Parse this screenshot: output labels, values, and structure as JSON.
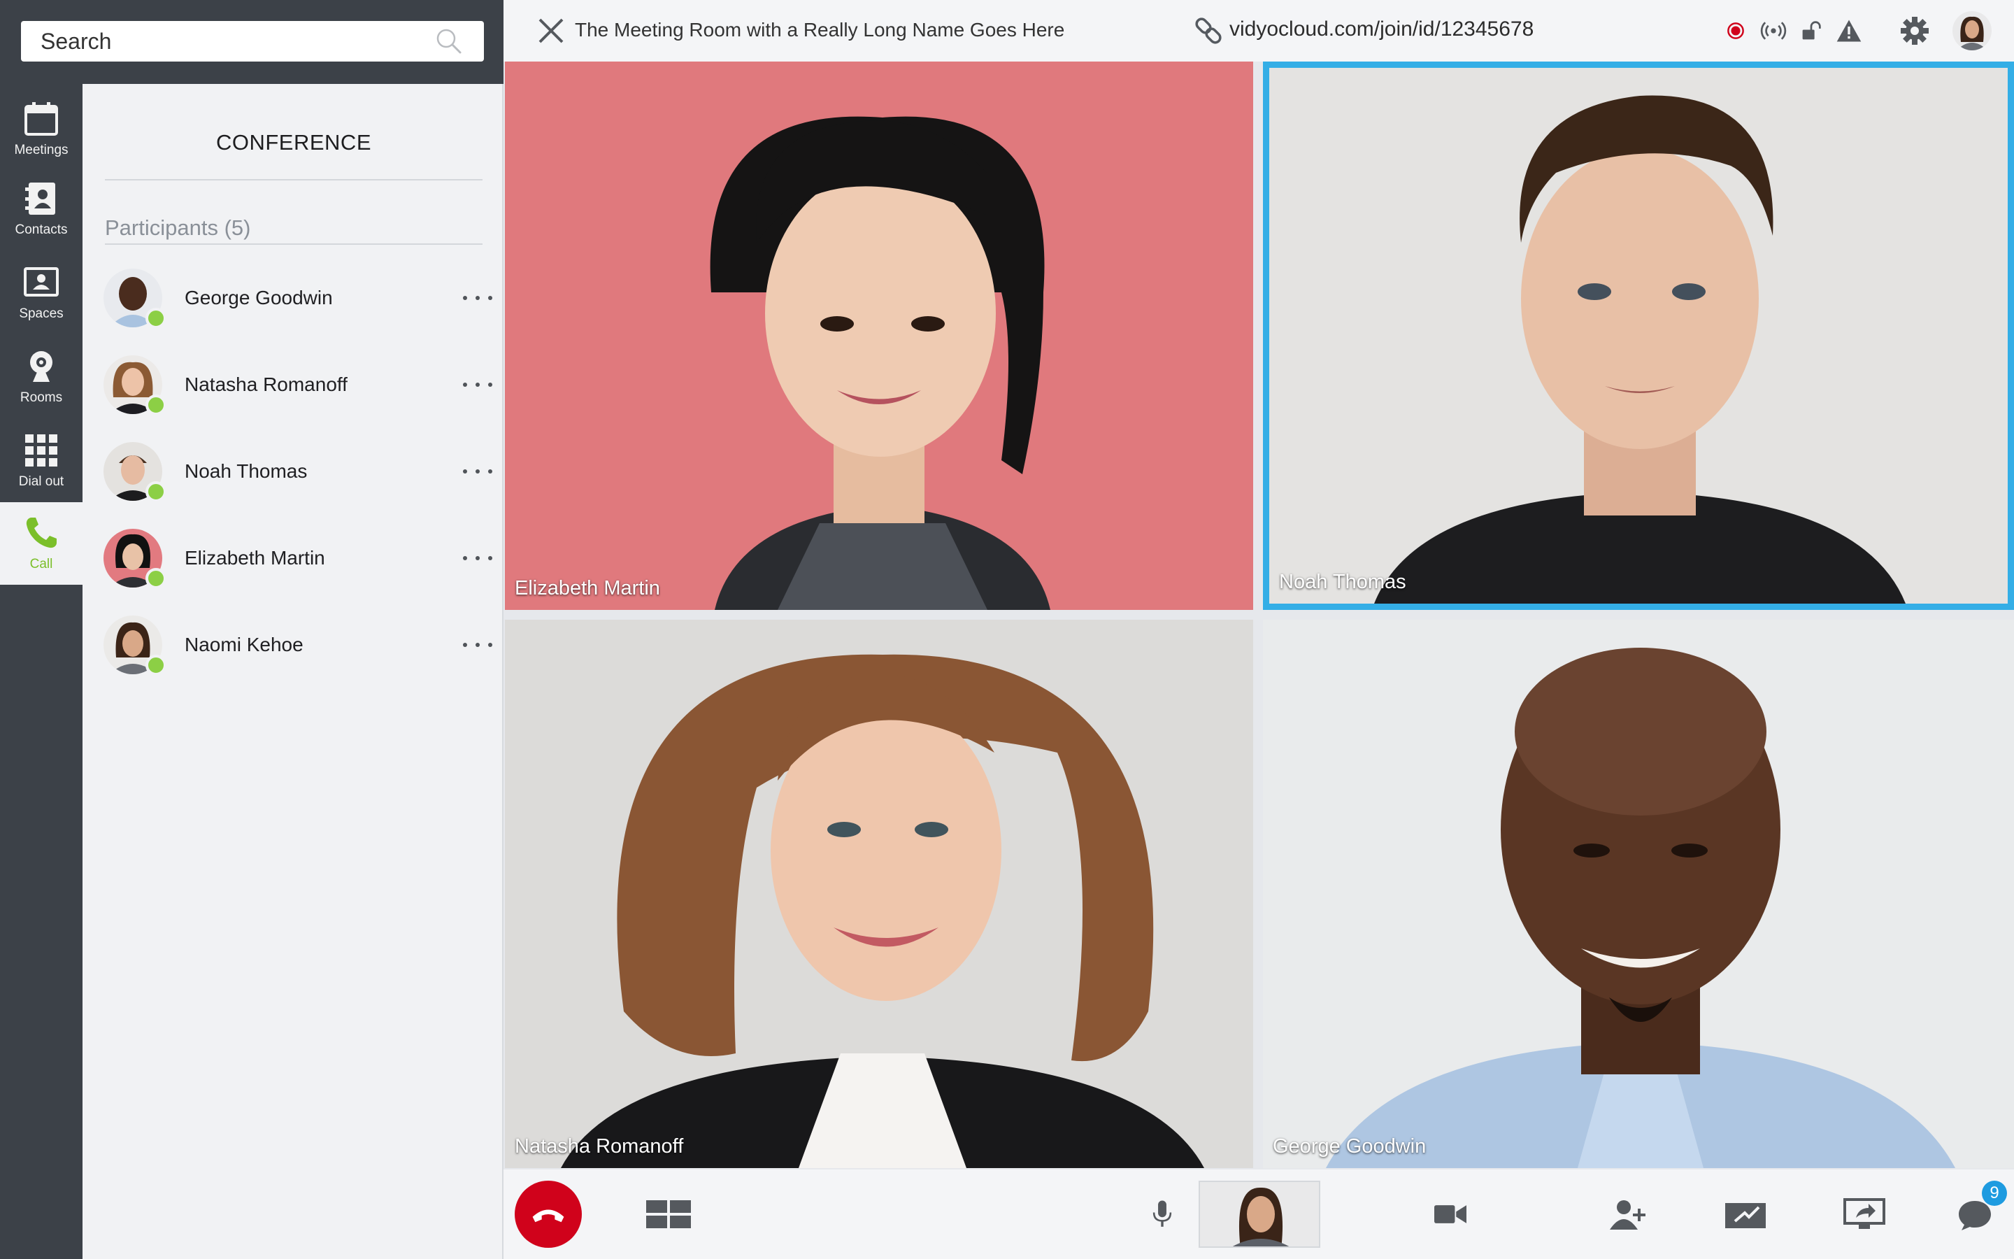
{
  "search": {
    "placeholder": "Search"
  },
  "nav": {
    "items": [
      {
        "label": "Meetings",
        "icon": "calendar-icon"
      },
      {
        "label": "Contacts",
        "icon": "contacts-icon"
      },
      {
        "label": "Spaces",
        "icon": "spaces-icon"
      },
      {
        "label": "Rooms",
        "icon": "webcam-icon"
      },
      {
        "label": "Dial out",
        "icon": "dialpad-icon"
      },
      {
        "label": "Call",
        "icon": "phone-icon",
        "active": true
      }
    ],
    "active_color": "#7bbf2a"
  },
  "panel": {
    "title": "CONFERENCE",
    "participants_heading": "Participants (5)",
    "participants": [
      {
        "name": "George Goodwin",
        "status": "online"
      },
      {
        "name": "Natasha Romanoff",
        "status": "online"
      },
      {
        "name": "Noah Thomas",
        "status": "online"
      },
      {
        "name": "Elizabeth Martin",
        "status": "online"
      },
      {
        "name": "Naomi Kehoe",
        "status": "online"
      }
    ],
    "online_color": "#8ccf45"
  },
  "call": {
    "room_name": "The Meeting Room with a Really Long Name Goes Here",
    "url": "vidyocloud.com/join/id/12345678",
    "status_icons": [
      "record-icon",
      "broadcast-icon",
      "unlocked-icon",
      "warning-icon"
    ],
    "record_color": "#d0021b",
    "tiles": [
      {
        "name": "Elizabeth Martin",
        "active_speaker": false
      },
      {
        "name": "Noah Thomas",
        "active_speaker": true
      },
      {
        "name": "Natasha Romanoff",
        "active_speaker": false
      },
      {
        "name": "George Goodwin",
        "active_speaker": false
      }
    ],
    "active_speaker_color": "#34aee6"
  },
  "toolbar": {
    "buttons": [
      "hangup-icon",
      "layout-grid-icon",
      "microphone-icon",
      "camera-icon",
      "add-participant-icon",
      "share-content-icon",
      "share-screen-icon",
      "chat-icon"
    ],
    "chat_unread": "9",
    "hangup_color": "#d0021b"
  }
}
